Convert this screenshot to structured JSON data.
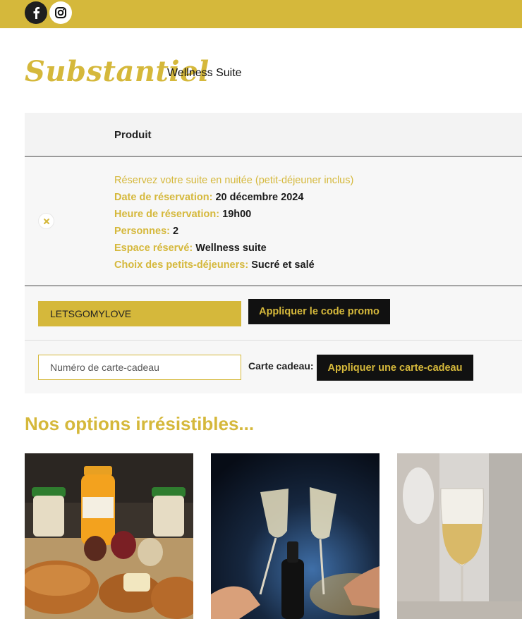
{
  "header": {
    "social": [
      {
        "name": "facebook",
        "icon": "facebook-icon"
      },
      {
        "name": "instagram",
        "icon": "instagram-icon"
      }
    ],
    "brand_color": "#d5b83b"
  },
  "logo": {
    "brand": "Substantiel",
    "subtitle": "Wellness Suite"
  },
  "cart": {
    "header_product": "Produit",
    "item": {
      "title": "Réservez votre suite en nuitée (petit-déjeuner inclus)",
      "details": [
        {
          "label": "Date de réservation:",
          "value": "20 décembre 2024"
        },
        {
          "label": "Heure de réservation:",
          "value": "19h00"
        },
        {
          "label": "Personnes:",
          "value": "2"
        },
        {
          "label": "Espace réservé:",
          "value": "Wellness suite"
        },
        {
          "label": "Choix des petits-déjeuners:",
          "value": "Sucré et salé"
        }
      ]
    },
    "promo": {
      "code_value": "LETSGOMYLOVE",
      "apply_label": "Appliquer le code promo"
    },
    "gift": {
      "placeholder": "Numéro de carte-cadeau",
      "label": "Carte cadeau:",
      "apply_label": "Appliquer une carte-cadeau"
    }
  },
  "options": {
    "title": "Nos options irrésistibles...",
    "cards": [
      {
        "subject": "breakfast-basket"
      },
      {
        "subject": "champagne-toast"
      },
      {
        "subject": "white-wine-glass"
      }
    ]
  }
}
